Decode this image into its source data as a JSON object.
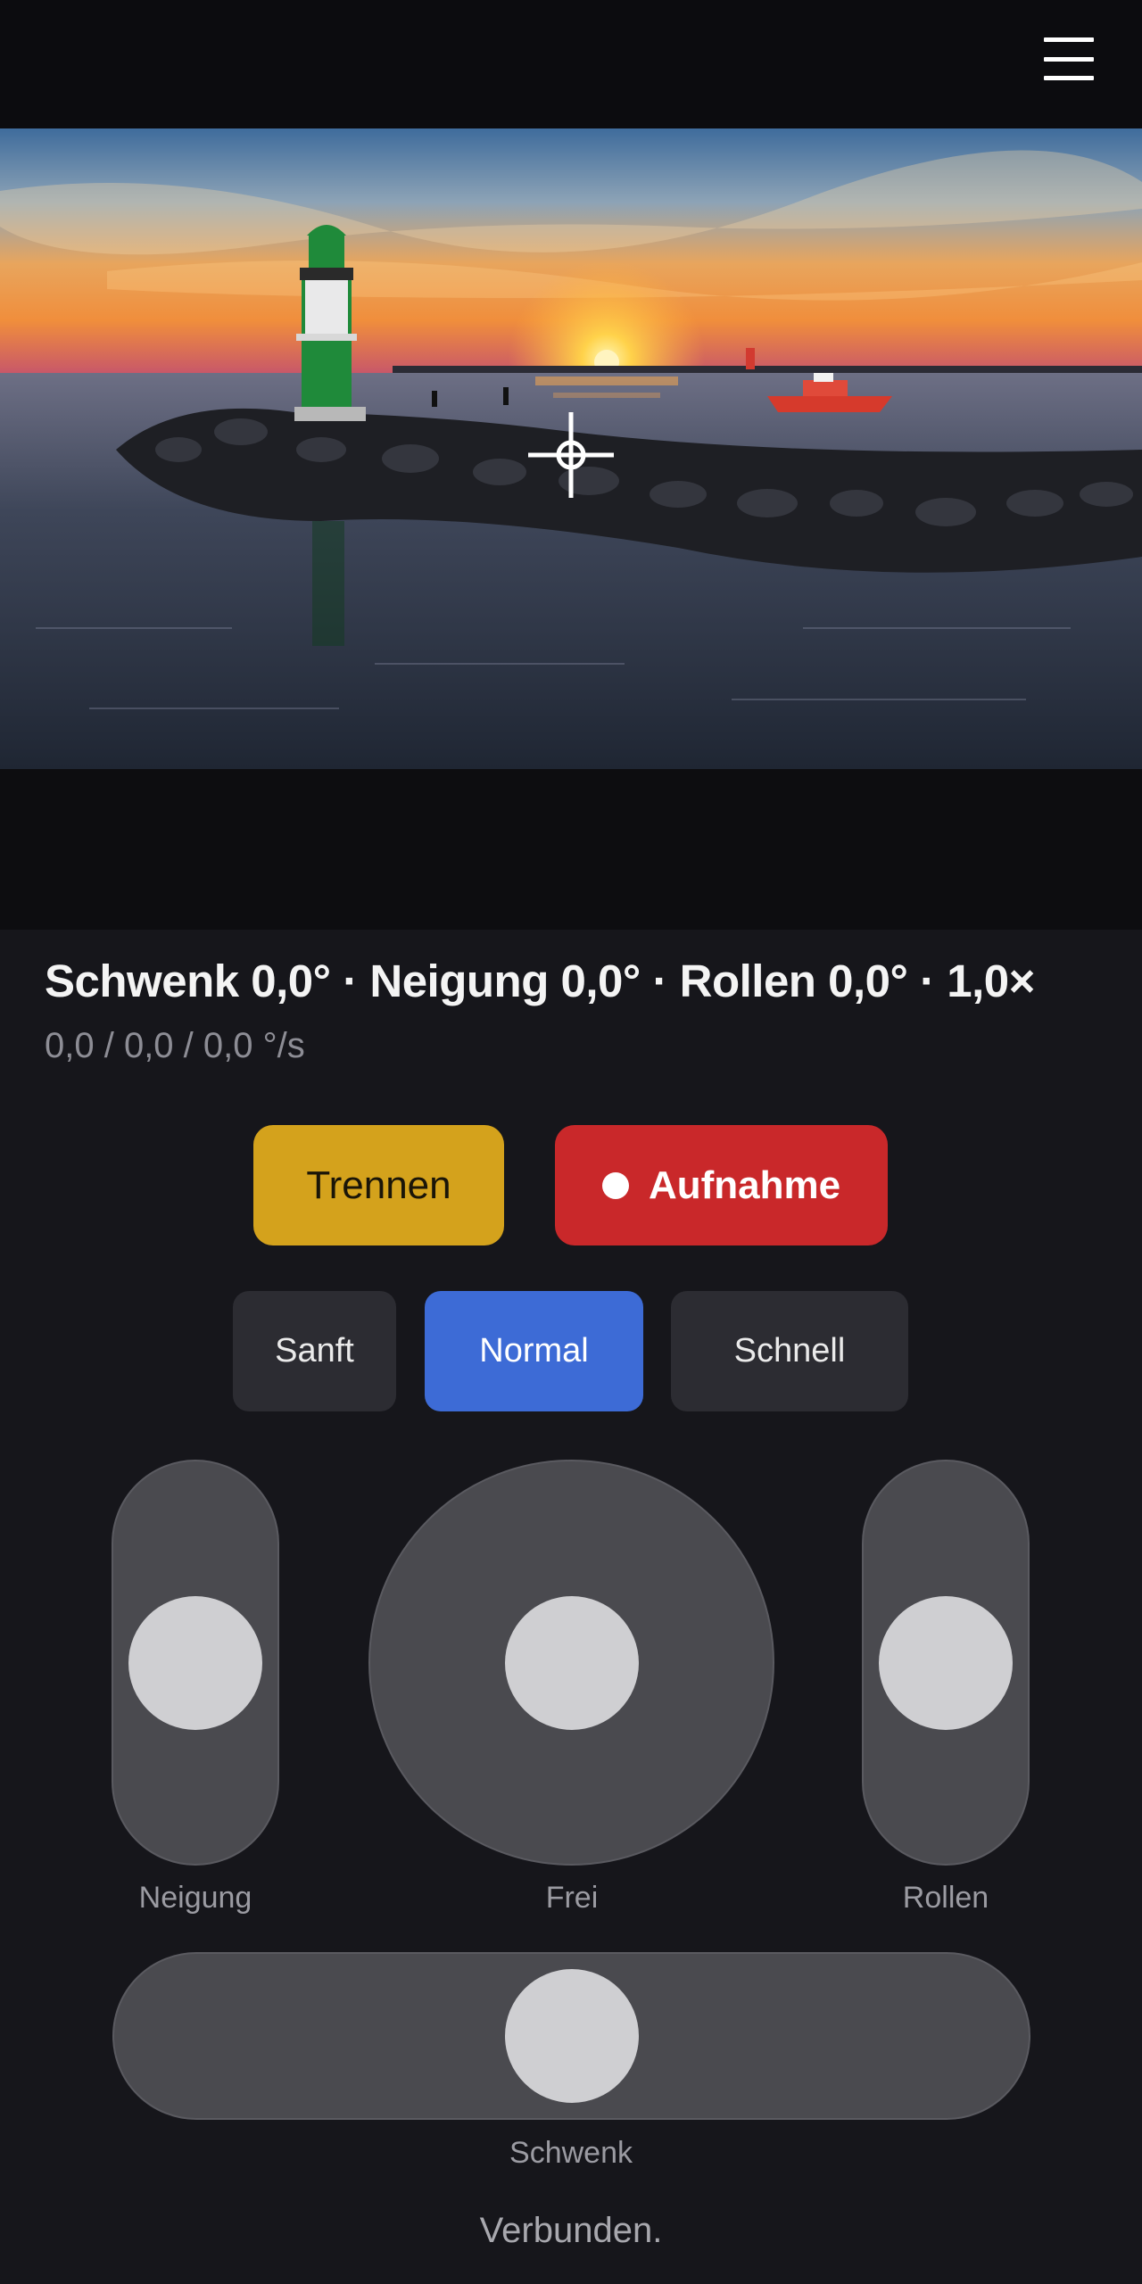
{
  "preview": {
    "scene": "Leuchtturm bei Sonnenuntergang"
  },
  "readout": {
    "orientation": "Schwenk 0,0° · Neigung 0,0° · Rollen 0,0° · 1,0×",
    "rates": "0,0 / 0,0 / 0,0 °/s"
  },
  "actions": {
    "disconnect_label": "Trennen",
    "record_label": "Aufnahme"
  },
  "speed_modes": {
    "options": [
      "Sanft",
      "Normal",
      "Schnell"
    ],
    "selected": "Normal"
  },
  "controls": {
    "tilt_label": "Neigung",
    "free_label": "Frei",
    "roll_label": "Rollen",
    "pan_label": "Schwenk",
    "tilt_value": 0.0,
    "roll_value": 0.0,
    "pan_value": 0.0
  },
  "status": "Verbunden.",
  "colors": {
    "accent": "#3d6bd6",
    "disconnect": "#d4a21c",
    "record": "#c9282a",
    "background": "#16161b"
  },
  "icons": [
    "menu-icon",
    "crosshair-icon",
    "record-dot-icon"
  ]
}
